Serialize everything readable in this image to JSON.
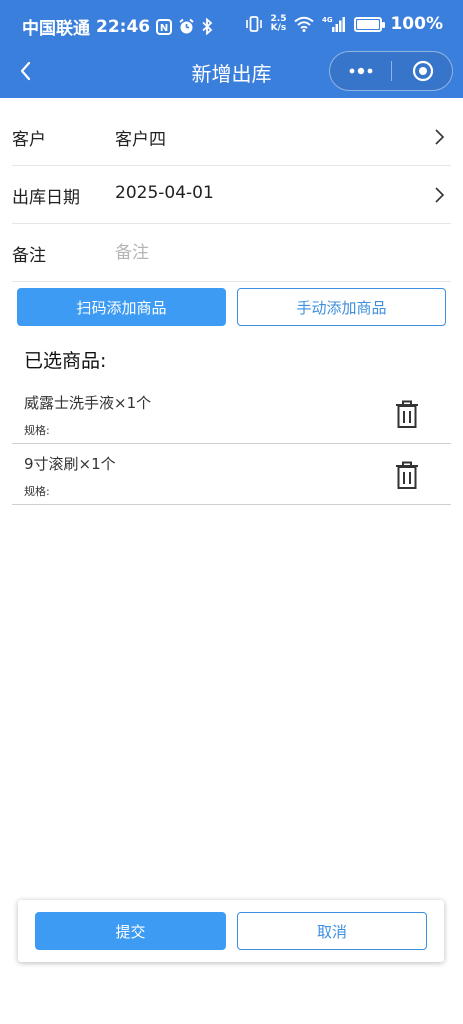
{
  "status_bar": {
    "carrier": "中国联通",
    "time": "22:46",
    "nfc_glyph": "N",
    "network_speed_value": "2.5",
    "network_speed_unit": "K/s",
    "network_type": "4G",
    "battery_percent": "100%",
    "battery_level": 1.0,
    "icons": [
      "nfc-icon",
      "alarm-icon",
      "bluetooth-icon",
      "vibrate-icon",
      "wifi-icon",
      "signal-icon",
      "battery-icon"
    ]
  },
  "navbar": {
    "title": "新增出库",
    "background_color": "#3b7fdc",
    "icons": [
      "back-icon",
      "more-icon",
      "close-target-icon"
    ]
  },
  "form": {
    "customer": {
      "label": "客户",
      "value": "客户四"
    },
    "date": {
      "label": "出库日期",
      "value": "2025-04-01"
    },
    "remark": {
      "label": "备注",
      "placeholder": "备注",
      "value": ""
    }
  },
  "actions": {
    "scan_add": "扫码添加商品",
    "manual_add": "手动添加商品"
  },
  "selected": {
    "title": "已选商品:",
    "items": [
      {
        "name": "威露士洗手液×1个",
        "spec": "规格:"
      },
      {
        "name": "9寸滚刷×1个",
        "spec": "规格:"
      }
    ]
  },
  "footer": {
    "submit": "提交",
    "cancel": "取消"
  },
  "colors": {
    "primary": "#3d9bf3",
    "outline": "#3d8fe0",
    "header": "#3b7fdc"
  }
}
